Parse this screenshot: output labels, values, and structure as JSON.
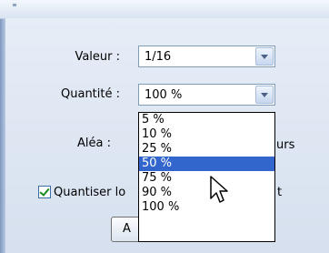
{
  "dialog": {
    "value_label": "Valeur :",
    "value_selected": "1/16",
    "quantity_label": "Quantité :",
    "quantity_selected": "100 %",
    "quantity_options": [
      "5 %",
      "10 %",
      "25 %",
      "50 %",
      "75 %",
      "90 %",
      "100 %"
    ],
    "quantity_highlighted": "50 %",
    "random_label": "Aléa :",
    "random_suffix_partial": "urs",
    "checkbox_label_partial": "Quantiser lo",
    "checkbox_suffix_partial": "t",
    "checkbox_checked": true,
    "button_label_partial": "A"
  }
}
